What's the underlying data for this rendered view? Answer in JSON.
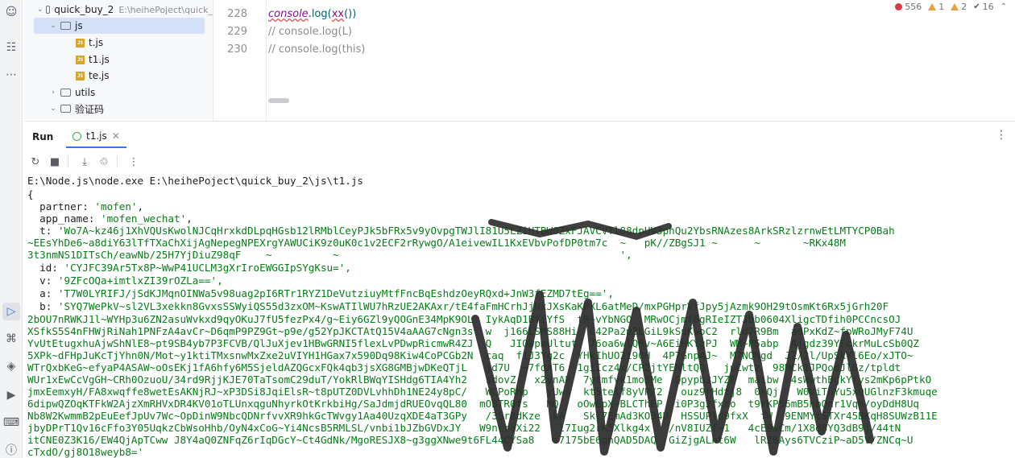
{
  "activity_icons": [
    "copilot-icon",
    "structure-icon",
    "more-icon",
    "run-icon",
    "python-packages-icon",
    "layers-icon",
    "services-icon",
    "terminal-icon",
    "problems-icon"
  ],
  "tree": {
    "project": "quick_buy_2",
    "project_path": "E:\\heihePoject\\quick_",
    "items": [
      {
        "type": "folder",
        "label": "js",
        "expanded": true,
        "selected": true
      },
      {
        "type": "file",
        "label": "t.js"
      },
      {
        "type": "file",
        "label": "t1.js"
      },
      {
        "type": "file",
        "label": "te.js"
      },
      {
        "type": "folder",
        "label": "utils",
        "expanded": false
      },
      {
        "type": "folder",
        "label": "验证码",
        "expanded": true
      }
    ]
  },
  "editor": {
    "lines": [
      {
        "num": "228",
        "console": "console",
        "call": ".log(",
        "arg": "xx",
        "tail": "())"
      },
      {
        "num": "229",
        "comment": "// console.log(L)"
      },
      {
        "num": "230",
        "comment": "// console.log(this)"
      }
    ],
    "inspections": {
      "errors": "556",
      "warnings": "1",
      "weak": "2",
      "checks": "16"
    }
  },
  "run": {
    "title": "Run",
    "tab_label": "t1.js"
  },
  "console": {
    "command": "E:\\Node.js\\node.exe E:\\heihePoject\\quick_buy_2\\js\\t1.js",
    "open_brace": "{",
    "partner_key": "partner",
    "partner_val": "'mofen'",
    "app_key": "app_name",
    "app_val": "'mofen_wechat'",
    "t_key": "t",
    "t_val": [
      "'Wo7A~kz46j1XhVQUsKwolNJCqHrxkdDLpqHGsb12lRMblCeyPJk5bFRx5v9yOvpgTWJlI81U5LZiHTBW0ZxFJAVCVTl88dpUV3phQu2YbsRNAzes8ArkSRzlzrnwEtLMTYCP0Bah",
      "~EEsYhDe6~a8diY63lTfTXaChXijAgNepegNPEXrgYAWUCiK9z0uK0c1v2ECF2rRywgO/A1eivewIL1KxEVbvPofDP0tm7c  ~   pK//ZBgSJ1 ~      ~       ~RKx48M",
      "3t3nmNS1DITsCh/eawNb/25H7YjDiuZ98qF    ~          ~                                              ',"
    ],
    "id_key": "id",
    "id_val": "'CYJFC39Ar5Tx8P~WwP41UCLM3gXrIroEWGGIpSYgKsu=',",
    "v_key": "v",
    "v_val": "'9ZFcOQa+imtlxZI39rOZLa==',",
    "a_key": "a",
    "a_val": "'T7W0LYRIFJ/jSdKJMqnOINWa5v98uag2pI6RTr1RYZ1DeVutziuyMtfFncBqEshdzOeyRQxd+JnW3fEZMD7tEg==',",
    "b_key": "b",
    "b_val": [
      "'SYQ7WePkV~sl2VL3xekkn8GvxsSSWyiQS55d3zxOM~KswATIlWU7hRzUE2AKAxr/tE4faFmHCrhJjNxJXsKaKPXL6atMeD/mxPGHprVfJpy5jAzmk9OH29tOsmKt6Rx5jGrh20F",
      "2bOU7nRWKJ1l~WYHp3u6ZN2asuWvkxd9qyOKuJ7fU5fezPx4/g~Eiy6GZl9yQOGnE34MpK9OL  IykAqD1BfiYfS  tR~vYbNGO  MRwOCjmf6gRIeIZTJbb0604XligcTDfih0PCCncsOJ",
      "XSfkS5S4nFHWjRiNah1PNFzA4avCr~D6qmP9PZ9Gt~p9e/g52YpJKCTAtQ15V4aAAG7cNgn3s  w  j166LSMS88Hi  C42Pa2p3LGiL9kSuKwoC2  rld7R9Bm  adPxKdZ~fpWRoJMyF74U",
      "YvUtEtugxhuAjwShNlE8~pt9SB4yb7P3FCVB/QlJuXjev1HBwGRNI5flexLvPDwpRicmwR4ZJ  Q   JIQwpmUltut  76oa6wlQRv~A6EiHKYgPJ  WM~P5abp  Ajgdz39YFckrMuLcSb0QZ",
      "5XPk~dFHpJuKcTjYhn0N/Mot~y1ktiTMxsnwMxZxe2uVIYH1HGax7x590Dq98Kiw4CoPCGb2N  caq  f1J3Yg2c  YHkIhUO2i90H  4P7GnpAJ~  M7NQNgd  JZ/2l/UpSkYl6Eo/xJTO~",
      "WTrQxbKeG~efyaP4ASAW~oOsEKj1fA6hfy6M5SjeldAZQGcxFQk4qb3jsXG8GMBjwDKeQTjL   jd7U  ~7fdAT6  1giIcz4x/CP2jtYENltQQ   juCwtz  98MCk1JPQodJlGz/tpldt",
      "WUr1xEwCcVgGH~CRh0OzuoU/34rd9RjjKJE70TaTsomC29duT/YokRlBWqYISHdg6TIA4Yh2   sdovZ   x2ynAP  7ytmfvk1mo3Me  Qpypb3JYZF  maibw  4sWwthBgkYfys2mKp6pPtkO",
      "jmxEemxyH/FA8xwqffe8wetEsAKNjRJ~xP3DSi8JqiElsR~t8pUTZ0DVLvhhDh1NE24y8pC/   WCPoRnp   yUws  kt5telf8yVP/2   ouz9rHdtj8  0kQj   W0ViThYu5xQUGlnzF3kmuqe",
      "6dipwQZOqKTFkW2AjzXmRHVxDR4KV01oTLUnxqguNhyrkOtKrkbiHg/SaJdmjdRUEOvqQL80  mOBTR0fs   MQ   oOw6pX~BLCThEP  i0P3g2fxXo  t9rKP56mB5hbQnr1Vqh/oyDdH8Uq",
      "Nb8W2KwmmB2pEuEefJpUv7Wc~OpDinW9NbcQDNrfvvXR9hkGcTWvgy1Aa40UzqXDE4aT3GPy   /3Sr8dKze  kA   Skl7EmAd3KO34U  HSSUPld9fxX  fW  9ENMYtSTXr45BKqH8SUWzB11E",
      "jbyDPrT1Qv16cFfo3Y05UqkzCbWsoHhb/OyN4xCoG~Yi4NcsB5RMLSL/vnbi1bJZbGVDxJY   W9ncraXi22   l7Iug2rK5Xlkg4x   /nV8IUZf~1   4cE9wCm/1X8d8YQ3dB9j/44tN",
      "itCNE0Z3K16/EW4QjApTCww J8Y4aQ0ZNFqZ6rIqDGcY~Ct4GdNk/MgoRESJX8~g3ggXNwe9t6FL44CYSa8   s7175bE6gnQAD5DAQ  GiZjgALht6W   lRZ6Ays6TVCziP~aD5V/ZNCq~U",
      "cTxdO/gj8O18weyb8='"
    ]
  }
}
